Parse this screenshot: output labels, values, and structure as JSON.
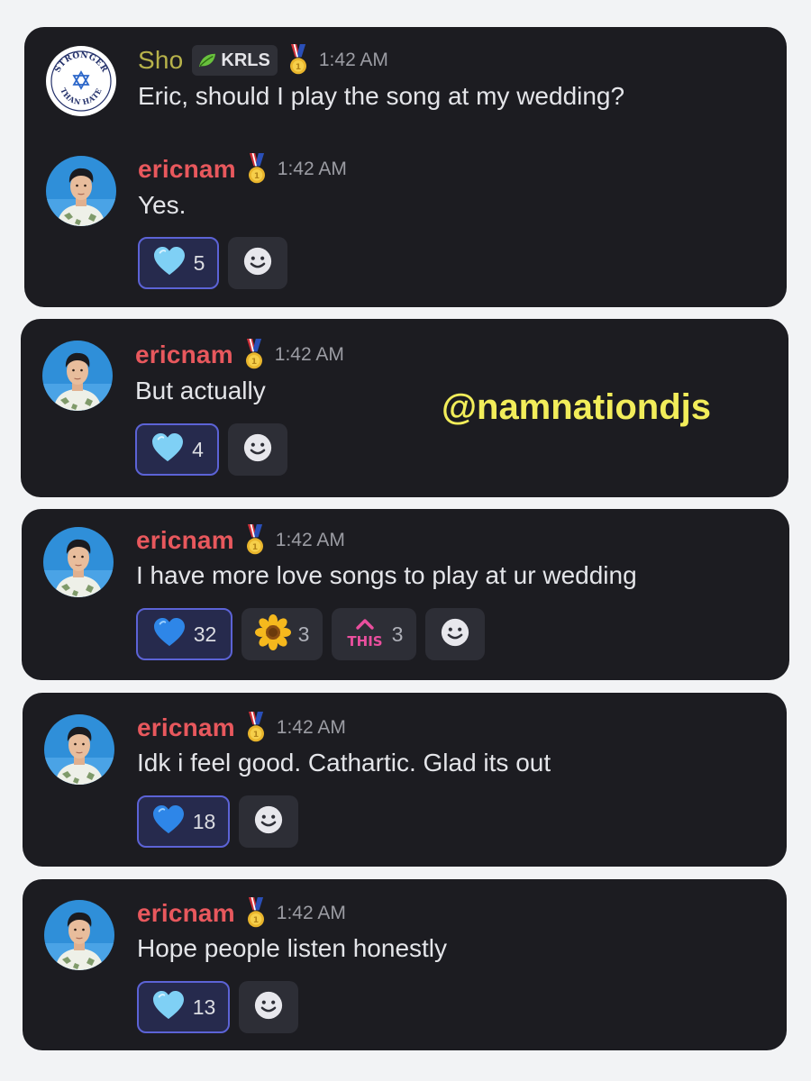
{
  "colors": {
    "card_bg": "#1c1c21",
    "username": "#e8585d",
    "sho_username": "#b7b24a",
    "timestamp": "#9b9ca3",
    "message_text": "#e4e5e9",
    "reaction_active_border": "#5c63d6",
    "watermark": "#f2ed5a"
  },
  "watermark": "@namnationdjs",
  "messages": [
    {
      "author": "Sho",
      "tag": "KRLS",
      "tag_icon": "leaf-icon",
      "badge_icon": "medal-icon",
      "avatar_icon": "stronger-than-hate-logo",
      "avatar_logo_text": "STRONGER THAN HATE",
      "time": "1:42 AM",
      "text": "Eric, should I play the song at my wedding?"
    },
    {
      "author": "ericnam",
      "badge_icon": "medal-icon",
      "time": "1:42 AM",
      "text": "Yes.",
      "reactions": [
        {
          "emoji": "light-blue-heart-icon",
          "count": "5",
          "active": true
        }
      ],
      "add_reaction_icon": "smiley-icon"
    },
    {
      "author": "ericnam",
      "badge_icon": "medal-icon",
      "time": "1:42 AM",
      "text": "But actually",
      "reactions": [
        {
          "emoji": "light-blue-heart-icon",
          "count": "4",
          "active": true
        }
      ],
      "add_reaction_icon": "smiley-icon"
    },
    {
      "author": "ericnam",
      "badge_icon": "medal-icon",
      "time": "1:42 AM",
      "text": "I have more love songs to play at ur wedding",
      "reactions": [
        {
          "emoji": "blue-heart-icon",
          "count": "32",
          "active": true
        },
        {
          "emoji": "sunflower-icon",
          "count": "3",
          "active": false
        },
        {
          "emoji": "this-arrow-icon",
          "emoji_text": "THIS",
          "count": "3",
          "active": false
        }
      ],
      "add_reaction_icon": "smiley-icon"
    },
    {
      "author": "ericnam",
      "badge_icon": "medal-icon",
      "time": "1:42 AM",
      "text": "Idk i feel good. Cathartic. Glad its out",
      "reactions": [
        {
          "emoji": "blue-heart-icon",
          "count": "18",
          "active": true
        }
      ],
      "add_reaction_icon": "smiley-icon"
    },
    {
      "author": "ericnam",
      "badge_icon": "medal-icon",
      "time": "1:42 AM",
      "text": "Hope people listen honestly",
      "reactions": [
        {
          "emoji": "light-blue-heart-icon",
          "count": "13",
          "active": true
        }
      ],
      "add_reaction_icon": "smiley-icon"
    }
  ]
}
